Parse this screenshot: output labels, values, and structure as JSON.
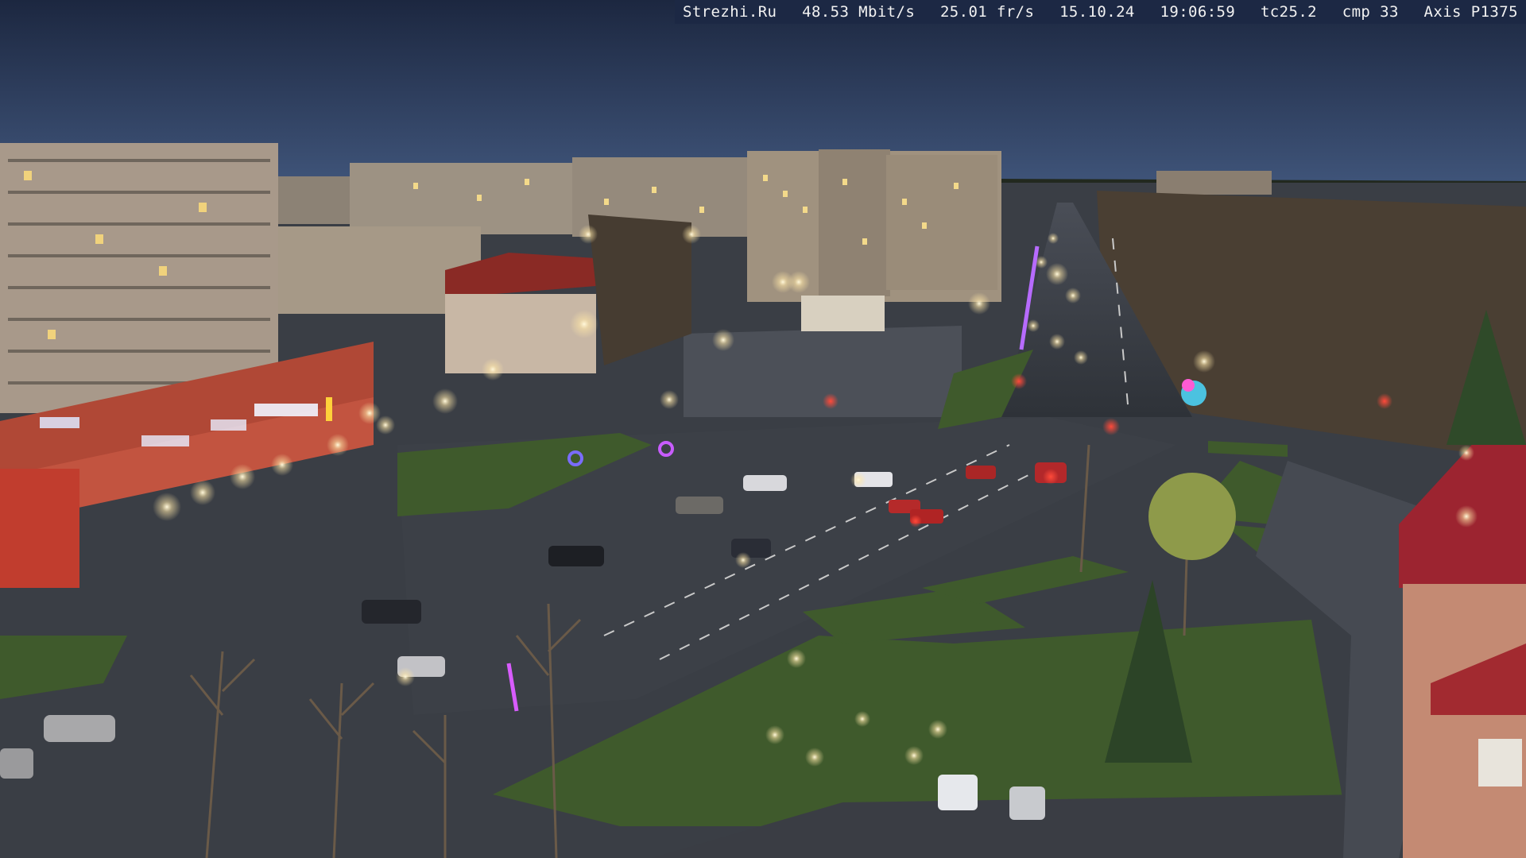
{
  "camera_overlay": {
    "site": "Strezhi.Ru",
    "bitrate": "48.53 Mbit/s",
    "framerate": "25.01 fr/s",
    "date": "15.10.24",
    "time": "19:06:59",
    "tc": "tc25.2",
    "cmp": "cmp 33",
    "camera_model": "Axis P1375"
  },
  "scene": {
    "sky_top_color": "#1e2a44",
    "sky_horizon_color": "#3d5178",
    "ground_color": "#3b3f46",
    "grass_color": "#3f5a2c",
    "building_color": "#a99a86",
    "brick_color": "#b24a36",
    "lamp_color": "#fff3cf"
  }
}
